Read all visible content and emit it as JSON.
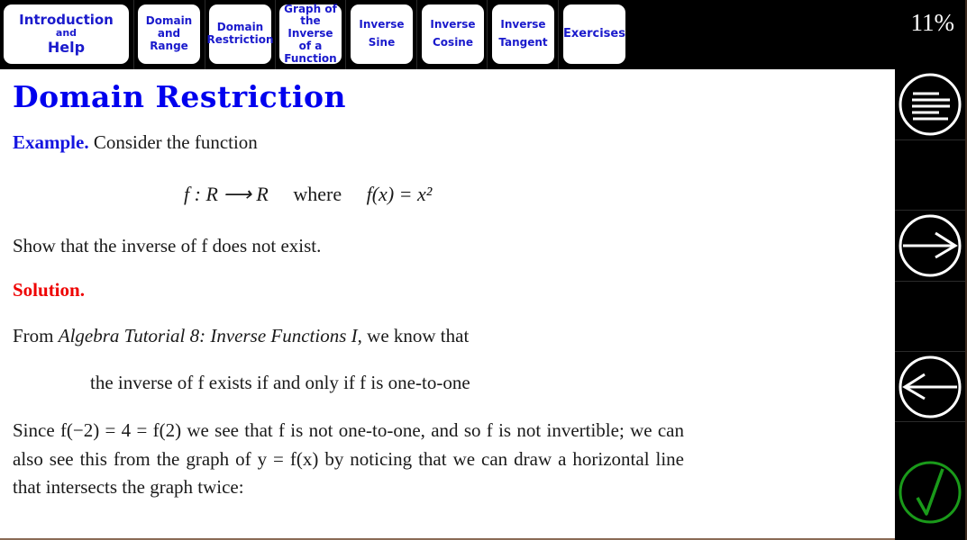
{
  "nav": {
    "buttons": [
      {
        "lines": [
          "Introduction",
          "and",
          "Help"
        ]
      },
      {
        "lines": [
          "Domain",
          "and",
          "Range"
        ]
      },
      {
        "lines": [
          "Domain",
          "Restriction"
        ]
      },
      {
        "lines": [
          "Graph of",
          "the Inverse",
          "of a",
          "Function"
        ]
      },
      {
        "lines": [
          "Inverse",
          "Sine"
        ]
      },
      {
        "lines": [
          "Inverse",
          "Cosine"
        ]
      },
      {
        "lines": [
          "Inverse",
          "Tangent"
        ]
      },
      {
        "lines": [
          "Exercises"
        ]
      }
    ],
    "progress": "11%"
  },
  "sidebar": {
    "menu": "menu-icon",
    "next": "arrow-right-icon",
    "prev": "arrow-left-icon",
    "check": "checkmark-icon",
    "check_color": "#1a9a1a"
  },
  "content": {
    "title": "Domain Restriction",
    "example_label": "Example.",
    "example_text": "Consider the function",
    "formula_map": "f : R ⟶ R",
    "formula_where": "where",
    "formula_def": "f(x) = x²",
    "task": "Show that the inverse of f does not exist.",
    "solution_label": "Solution.",
    "from_text_1": "From",
    "from_ref": "Algebra Tutorial 8: Inverse Functions I",
    "from_text_2": ", we know that",
    "theorem": "the inverse of f exists if and only if f is one-to-one",
    "paragraph": "Since f(−2) = 4 = f(2) we see that f is not one-to-one, and so f is not invertible; we can also see this from the graph of y = f(x) by noticing that we can draw a horizontal line that intersects the graph twice:"
  }
}
